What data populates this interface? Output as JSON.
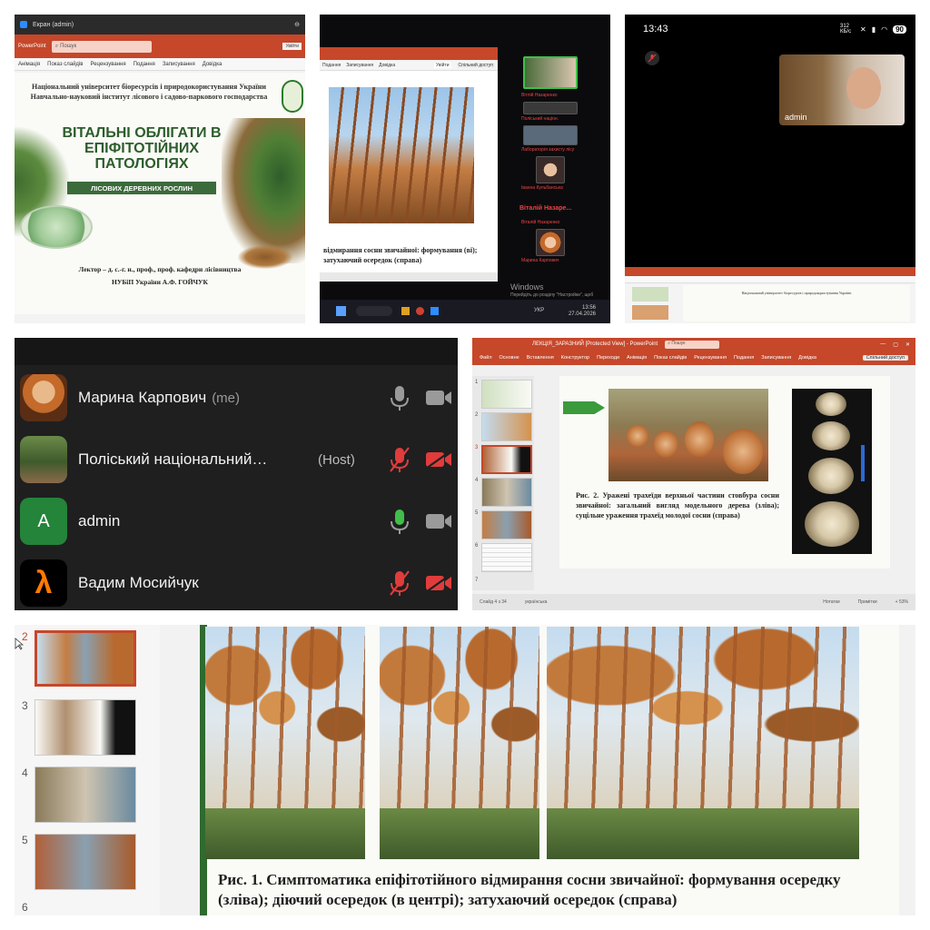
{
  "tile1": {
    "window_title": "Екран (admin)",
    "app_name": "PowerPoint",
    "search_placeholder": "Пошук",
    "account_button": "Увійти",
    "tabs": [
      "Анімація",
      "Показ слайдів",
      "Рецензування",
      "Подання",
      "Записування",
      "Довідка"
    ],
    "institution": "Національний університет біоресурсів і природокористування України",
    "institute": "Навчально-науковий інститут лісового і садово-паркового господарства",
    "title": "ВІТАЛЬНІ ОБЛІГАТИ В ЕПІФІТОТІЙНИХ ПАТОЛОГІЯХ",
    "subtitle": "ЛІСОВИХ ДЕРЕВНИХ РОСЛИН",
    "lector": "Лектор – д. с.-г. н., проф., проф. кафедри лісівництва",
    "lector_name": "НУБіП України А.Ф. ГОЙЧУК"
  },
  "tile2": {
    "tabs": [
      "Подання",
      "Записування",
      "Довідка"
    ],
    "account_button": "Увійти",
    "share_button": "Спільний доступ",
    "caption": "відмирання сосни звичайної: формування (ві); затухаючий осередок (справа)",
    "participants": [
      "Вітлій Назаренко",
      "Поліський націон.",
      "Лабораторія захисту лісу",
      "Іванна Кульбанська"
    ],
    "active_speaker": "Віталій Назаре...",
    "speaker_sub": "Віталій Назаренко",
    "bottom_participant": "Марина Карпович",
    "windows_activation": "Windows",
    "windows_hint": "Перейдіть до розділу \"Настройки\", щоб активувати Windows.",
    "lang": "УКР",
    "time": "13:56",
    "date": "27.04.2026"
  },
  "tile3": {
    "clock": "13:43",
    "speed": "312 КБ/с",
    "battery": "90",
    "video_label": "admin",
    "slide_text": "Національний університет біоресурсів і природокористування України"
  },
  "tile4": {
    "participants": [
      {
        "name": "Марина Карпович",
        "tag": "(me)",
        "role": "",
        "avatar": "photo",
        "mic": "on",
        "cam": "off-gray"
      },
      {
        "name": "Поліський національний…",
        "tag": "",
        "role": "(Host)",
        "avatar": "photo",
        "mic": "muted",
        "cam": "muted"
      },
      {
        "name": "admin",
        "tag": "",
        "role": "",
        "avatar_letter": "A",
        "avatar": "letter",
        "mic": "active",
        "cam": "off-gray"
      },
      {
        "name": "Вадим Мосийчук",
        "tag": "",
        "role": "",
        "avatar_letter": "λ",
        "avatar": "lambda",
        "mic": "muted",
        "cam": "muted"
      }
    ],
    "colors": {
      "muted": "#e03c3c",
      "active_mic": "#3fbf4a",
      "idle": "#9a9a9a"
    }
  },
  "tile5": {
    "doc_title": "ЛЕКЦІЯ_ЗАРАЗНИЙ [Protected View] - PowerPoint",
    "search_placeholder": "Пошук",
    "tabs": [
      "Файл",
      "Основне",
      "Вставлення",
      "Конструктор",
      "Переходи",
      "Анімація",
      "Показ слайдів",
      "Рецензування",
      "Подання",
      "Записування",
      "Довідка"
    ],
    "share_button": "Спільний доступ",
    "thumb_numbers": [
      "1",
      "2",
      "3",
      "4",
      "5",
      "6",
      "7"
    ],
    "caption": "Рис. 2. Уражені трахеїди верхньої частини стовбура сосни звичайної: загальний вигляд модельного дерева (зліва); суцільне ураження трахеїд молодої сосни (справа)",
    "status_slide": "Слайд 4 з 34",
    "status_lang": "українська",
    "status_notes": "Нотатки",
    "status_comments": "Примітки",
    "zoom": "+ 53%"
  },
  "tile6": {
    "thumb_numbers": [
      "2",
      "3",
      "4",
      "5",
      "6"
    ],
    "caption": "Рис. 1. Симптоматика епіфітотійного відмирання сосни звичайної: формування осередку (зліва); діючий осередок (в центрі); затухаючий осередок (справа)"
  },
  "colors": {
    "ppt_red": "#c6472a",
    "forest_green": "#2f6b2f",
    "zoom_dark": "#1f1f1f"
  }
}
